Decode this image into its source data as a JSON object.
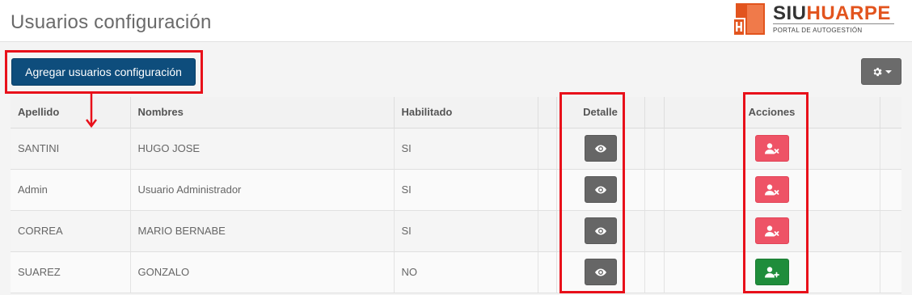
{
  "page": {
    "title": "Usuarios configuración"
  },
  "logo": {
    "name_part1": "SIU",
    "name_part2": "HUARPE",
    "subtitle": "PORTAL DE AUTOGESTIÓN",
    "icon": "siu-huarpe-logo-icon",
    "accent_color": "#e2541e"
  },
  "toolbar": {
    "add_button_label": "Agregar usuarios configuración",
    "settings_icon": "gear-icon",
    "settings_caret_icon": "caret-down-icon"
  },
  "table": {
    "headers": {
      "apellido": "Apellido",
      "nombres": "Nombres",
      "habilitado": "Habilitado",
      "extra": "",
      "detalle": "Detalle",
      "spacer": "",
      "acciones": "Acciones",
      "trailing": ""
    },
    "rows": [
      {
        "apellido": "SANTINI",
        "nombres": "HUGO JOSE",
        "habilitado": "SI",
        "detail_icon": "eye-icon",
        "action_icon": "user-remove-icon",
        "action_color": "#ee5366"
      },
      {
        "apellido": "Admin",
        "nombres": "Usuario Administrador",
        "habilitado": "SI",
        "detail_icon": "eye-icon",
        "action_icon": "user-remove-icon",
        "action_color": "#ee5366"
      },
      {
        "apellido": "CORREA",
        "nombres": "MARIO BERNABE",
        "habilitado": "SI",
        "detail_icon": "eye-icon",
        "action_icon": "user-remove-icon",
        "action_color": "#ee5366"
      },
      {
        "apellido": "SUAREZ",
        "nombres": "GONZALO",
        "habilitado": "NO",
        "detail_icon": "eye-icon",
        "action_icon": "user-add-icon",
        "action_color": "#1f8d3b"
      }
    ]
  },
  "annotations": {
    "highlight_color": "#e8101a",
    "arrow_icon": "arrow-down-icon"
  }
}
